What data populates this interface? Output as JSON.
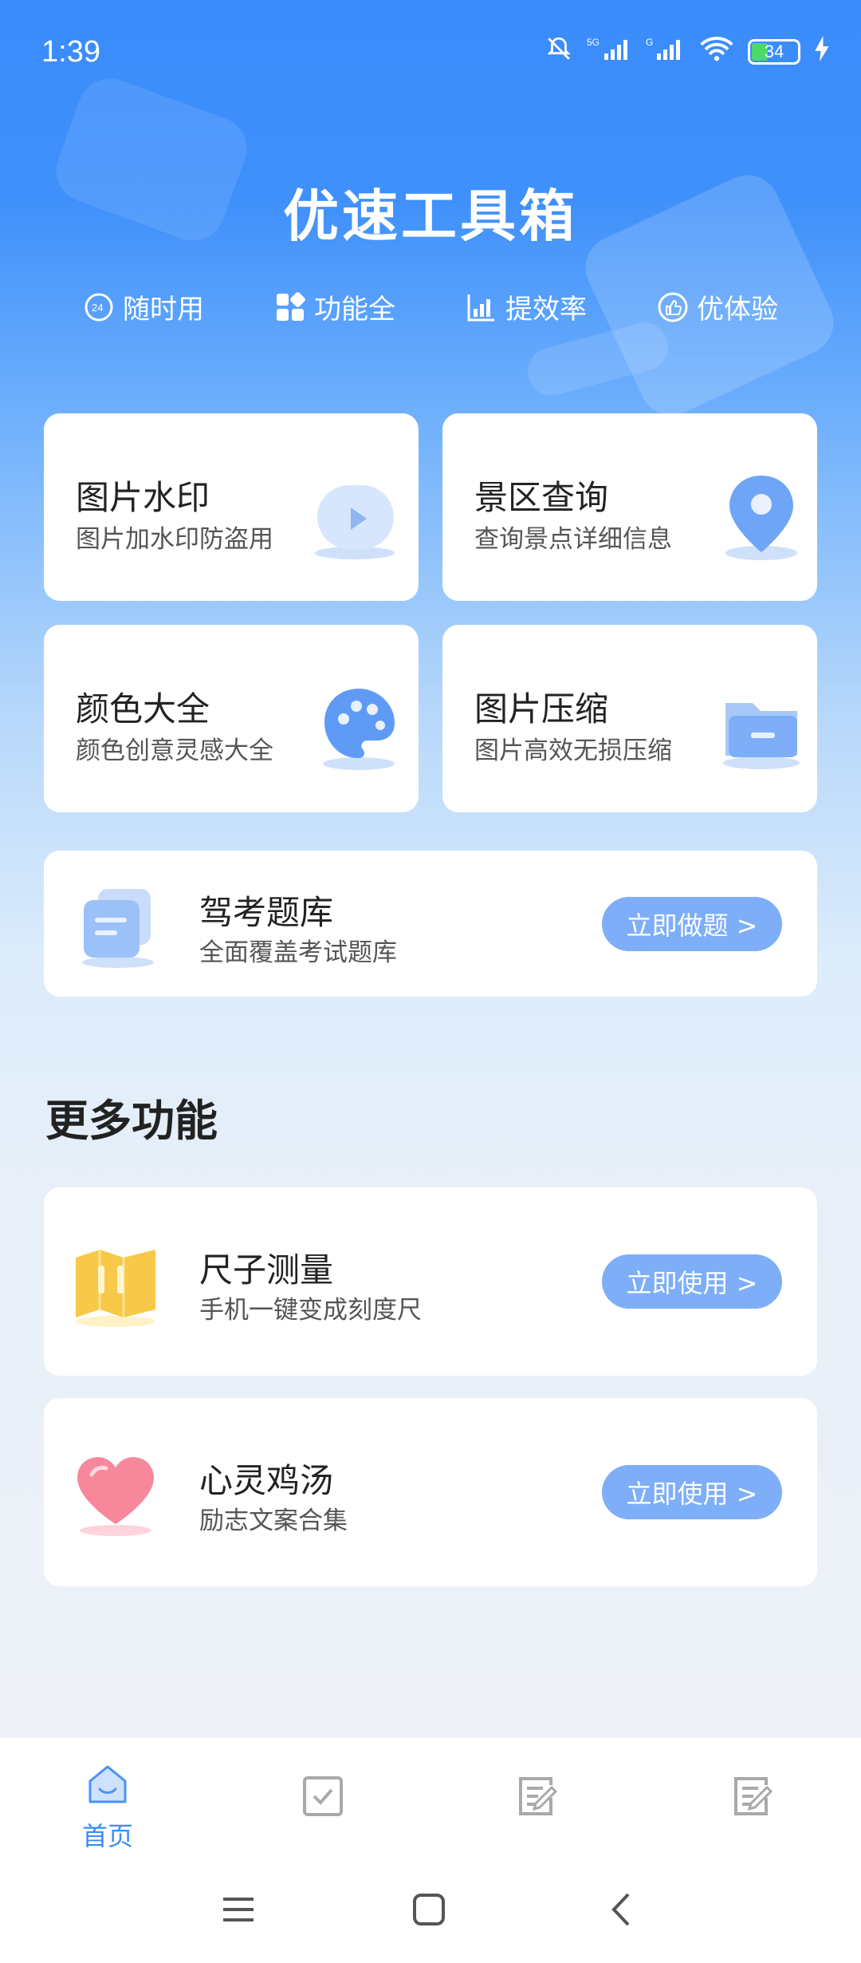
{
  "status": {
    "time": "1:39",
    "battery": "34",
    "network": "5G"
  },
  "header": {
    "title": "优速工具箱"
  },
  "features": [
    {
      "label": "随时用",
      "icon": "clock-24-icon"
    },
    {
      "label": "功能全",
      "icon": "grid-icon"
    },
    {
      "label": "提效率",
      "icon": "bar-chart-icon"
    },
    {
      "label": "优体验",
      "icon": "thumbs-up-icon"
    }
  ],
  "tools": [
    {
      "title": "图片水印",
      "subtitle": "图片加水印防盗用",
      "icon": "play-icon"
    },
    {
      "title": "景区查询",
      "subtitle": "查询景点详细信息",
      "icon": "location-pin-icon"
    },
    {
      "title": "颜色大全",
      "subtitle": "颜色创意灵感大全",
      "icon": "palette-icon"
    },
    {
      "title": "图片压缩",
      "subtitle": "图片高效无损压缩",
      "icon": "folder-icon"
    }
  ],
  "exam": {
    "title": "驾考题库",
    "subtitle": "全面覆盖考试题库",
    "button": "立即做题 >",
    "icon": "chat-bubbles-icon"
  },
  "more": {
    "title": "更多功能",
    "items": [
      {
        "title": "尺子测量",
        "subtitle": "手机一键变成刻度尺",
        "button": "立即使用 >",
        "icon": "map-ruler-icon"
      },
      {
        "title": "心灵鸡汤",
        "subtitle": "励志文案合集",
        "button": "立即使用 >",
        "icon": "heart-icon"
      }
    ]
  },
  "bottom_nav": {
    "home_label": "首页"
  },
  "colors": {
    "primary": "#3d8cf5",
    "button": "#7eaef8",
    "header_bg": "#3a8cfb"
  }
}
